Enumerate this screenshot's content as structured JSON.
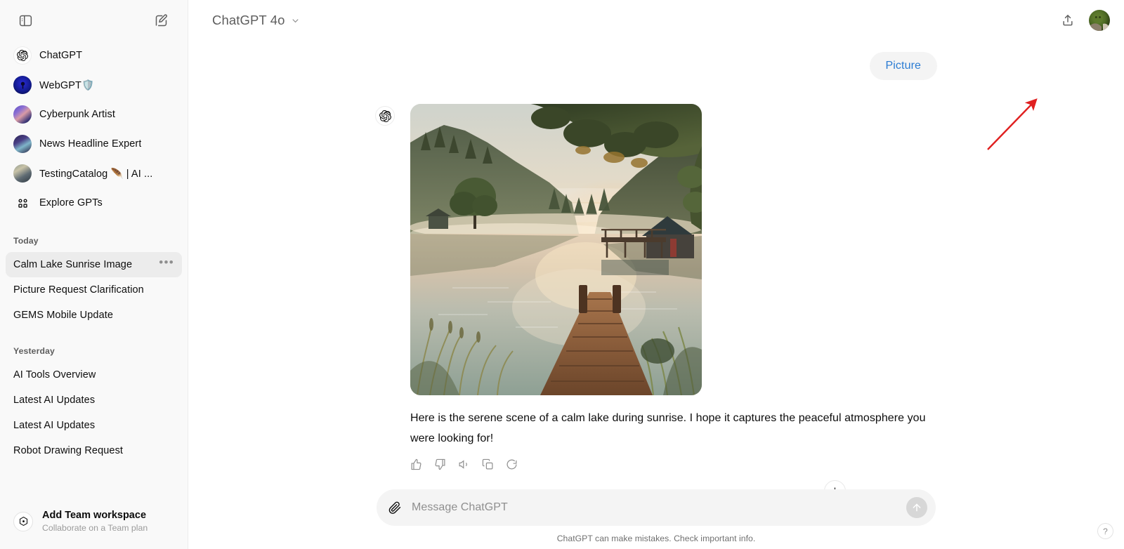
{
  "sidebar": {
    "toggle_icon": "sidebar-panel-icon",
    "new_chat_icon": "new-chat-pencil-icon",
    "gpts": [
      {
        "label": "ChatGPT",
        "icon": "openai-logo-icon"
      },
      {
        "label": "WebGPT🛡️",
        "icon": "webgpt-avatar"
      },
      {
        "label": "Cyberpunk Artist",
        "icon": "cyberpunk-artist-avatar"
      },
      {
        "label": "News Headline Expert",
        "icon": "news-headline-expert-avatar"
      },
      {
        "label": "TestingCatalog 🪶 | AI ...",
        "icon": "testingcatalog-avatar"
      },
      {
        "label": "Explore GPTs",
        "icon": "explore-gpts-grid-icon"
      }
    ],
    "groups": [
      {
        "title": "Today",
        "chats": [
          {
            "title": "Calm Lake Sunrise Image",
            "active": true,
            "more": "•••"
          },
          {
            "title": "Picture Request Clarification",
            "active": false
          },
          {
            "title": "GEMS Mobile Update",
            "active": false
          }
        ]
      },
      {
        "title": "Yesterday",
        "chats": [
          {
            "title": "AI Tools Overview",
            "active": false
          },
          {
            "title": "Latest AI Updates",
            "active": false
          },
          {
            "title": "Latest AI Updates",
            "active": false
          },
          {
            "title": "Robot Drawing Request",
            "active": false
          }
        ]
      }
    ],
    "team": {
      "title": "Add Team workspace",
      "subtitle": "Collaborate on a Team plan",
      "icon": "team-workspace-icon"
    }
  },
  "header": {
    "model": "ChatGPT 4o",
    "chevron_icon": "chevron-down-icon",
    "share_icon": "share-upload-icon",
    "avatar": "user-avatar"
  },
  "conversation": {
    "user_message": "Picture",
    "assistant": {
      "avatar_icon": "openai-logo-icon",
      "image_alt": "Calm lake at sunrise with wooden dock, misty forested hills and a boathouse",
      "text": "Here is the serene scene of a calm lake during sunrise. I hope it captures the peaceful atmosphere you were looking for!",
      "actions": [
        "thumbs-up-icon",
        "thumbs-down-icon",
        "speaker-read-aloud-icon",
        "copy-icon",
        "regenerate-icon"
      ]
    },
    "scroll_down_icon": "arrow-down-icon"
  },
  "composer": {
    "attach_icon": "paperclip-icon",
    "placeholder": "Message ChatGPT",
    "value": "",
    "send_icon": "arrow-up-send-icon"
  },
  "footer": {
    "disclaimer": "ChatGPT can make mistakes. Check important info.",
    "help_label": "?"
  },
  "annotation": {
    "type": "red-arrow",
    "color": "#e02020",
    "points_to": "user-message-bubble"
  },
  "colors": {
    "sidebar_bg": "#f9f9f9",
    "bubble_bg": "#f4f4f4",
    "user_text_blue": "#2b7cd3",
    "text_primary": "#0d0d0d",
    "text_muted": "#8f8f8f",
    "annotation_red": "#e02020"
  }
}
